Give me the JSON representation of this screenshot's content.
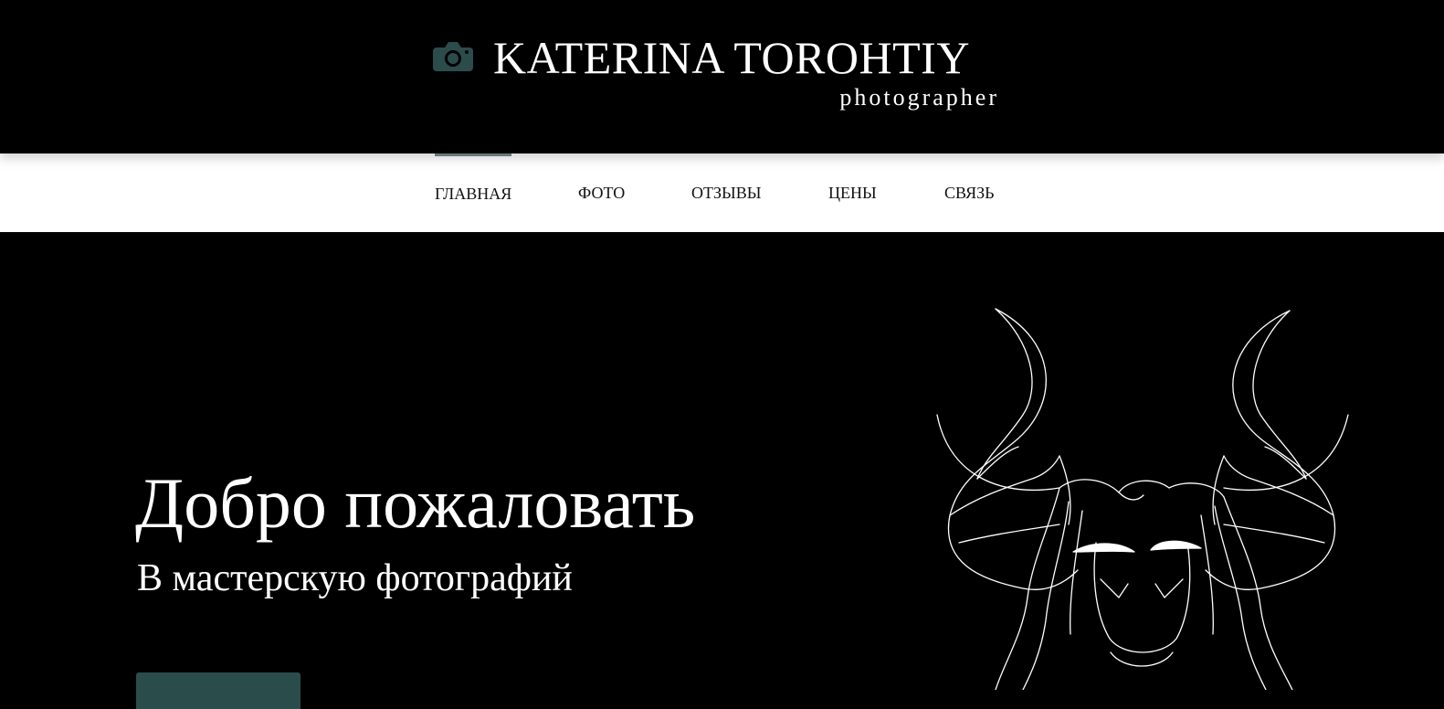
{
  "header": {
    "logo_icon": "camera-icon",
    "brand_name": "KATERINA TOROHTIY",
    "brand_tagline": "photographer",
    "accent_color": "#2a4d4c"
  },
  "nav": {
    "items": [
      {
        "label": "ГЛАВНАЯ",
        "active": true
      },
      {
        "label": "ФОТО",
        "active": false
      },
      {
        "label": "ОТЗЫВЫ",
        "active": false
      },
      {
        "label": "ЦЕНЫ",
        "active": false
      },
      {
        "label": "СВЯЗЬ",
        "active": false
      }
    ]
  },
  "hero": {
    "title": "Добро пожаловать",
    "subtitle": "В мастерскую фотографий",
    "button_label": "",
    "illustration": "horned-figure-line-art"
  }
}
